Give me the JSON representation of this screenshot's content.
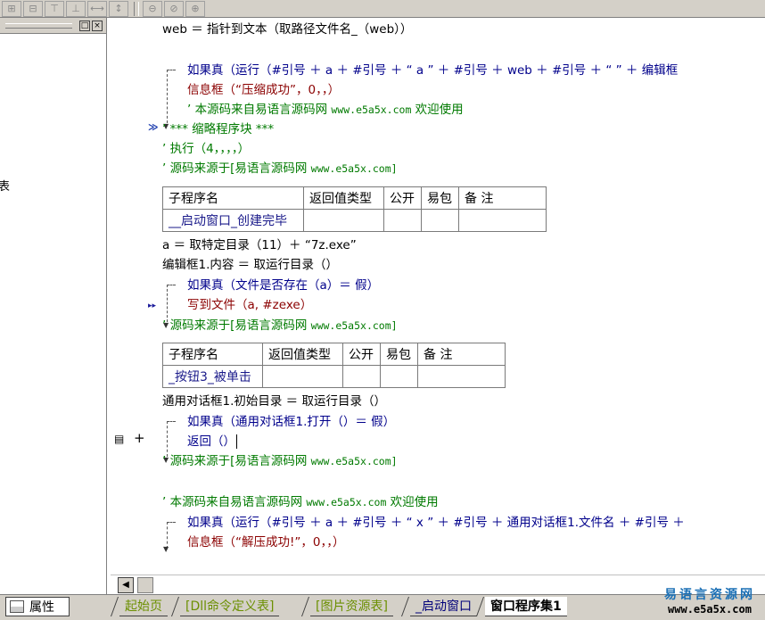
{
  "left_panel": {
    "restore_btn": "□",
    "close_btn": "×",
    "fragment": "表"
  },
  "gutter": {
    "fold_marker_1": "≫",
    "fold_marker_2": "▸▸",
    "var_marker": "+"
  },
  "code": {
    "l1": "web ＝ 指针到文本（取路径文件名_（web））",
    "l2a": "如果真（运行（#引号 ＋ a ＋ #引号 ＋ “ a ” ＋ #引号 ＋ web ＋ #引号 ＋ “ ” ＋ 编辑框",
    "l3": "信息框（“压缩成功”，0，，）",
    "l4a": "’ 本源码来自易语言源码网 ",
    "l4b": "www.e5a5x.com",
    "l4c": " 欢迎使用",
    "l5": "’ *** 缩略程序块 ***",
    "l6": "’ 执行（4，，，，）",
    "l7a": "’ 源码来源于[易语言源码网 ",
    "l7b": "www.e5a5x.com]",
    "l8": "a ＝ 取特定目录（11）＋ “7z.exe”",
    "l9": "编辑框1.内容 ＝ 取运行目录（）",
    "l10": "如果真（文件是否存在（a）＝ 假）",
    "l11": "写到文件（a, #zexe）",
    "l12a": "’ 源码来源于[易语言源码网 ",
    "l12b": "www.e5a5x.com]",
    "l13": "通用对话框1.初始目录 ＝ 取运行目录（）",
    "l14": "如果真（通用对话框1.打开（）＝ 假）",
    "l15": "返回（）",
    "l16a": "’ 源码来源于[易语言源码网 ",
    "l16b": "www.e5a5x.com]",
    "l17a": "’ 本源码来自易语言源码网 ",
    "l17b": "www.e5a5x.com",
    "l17c": " 欢迎使用",
    "l18": "如果真（运行（#引号 ＋ a ＋ #引号 ＋ “ x ” ＋ #引号 ＋ 通用对话框1.文件名 ＋ #引号 ＋",
    "l19": "信息框（“解压成功!”，0，，）"
  },
  "table1": {
    "headers": [
      "子程序名",
      "返回值类型",
      "公开",
      "易包",
      "备 注"
    ],
    "name": "__启动窗口_创建完毕"
  },
  "table2": {
    "headers": [
      "子程序名",
      "返回值类型",
      "公开",
      "易包",
      "备 注"
    ],
    "name": "_按钮3_被单击"
  },
  "tabs": {
    "properties": "属性",
    "items": [
      "起始页",
      "[Dll命令定义表]",
      "[图片资源表]",
      "_启动窗口",
      "窗口程序集1"
    ]
  },
  "logo": {
    "cn": "易语言资源网",
    "en": "www.e5a5x.com"
  }
}
